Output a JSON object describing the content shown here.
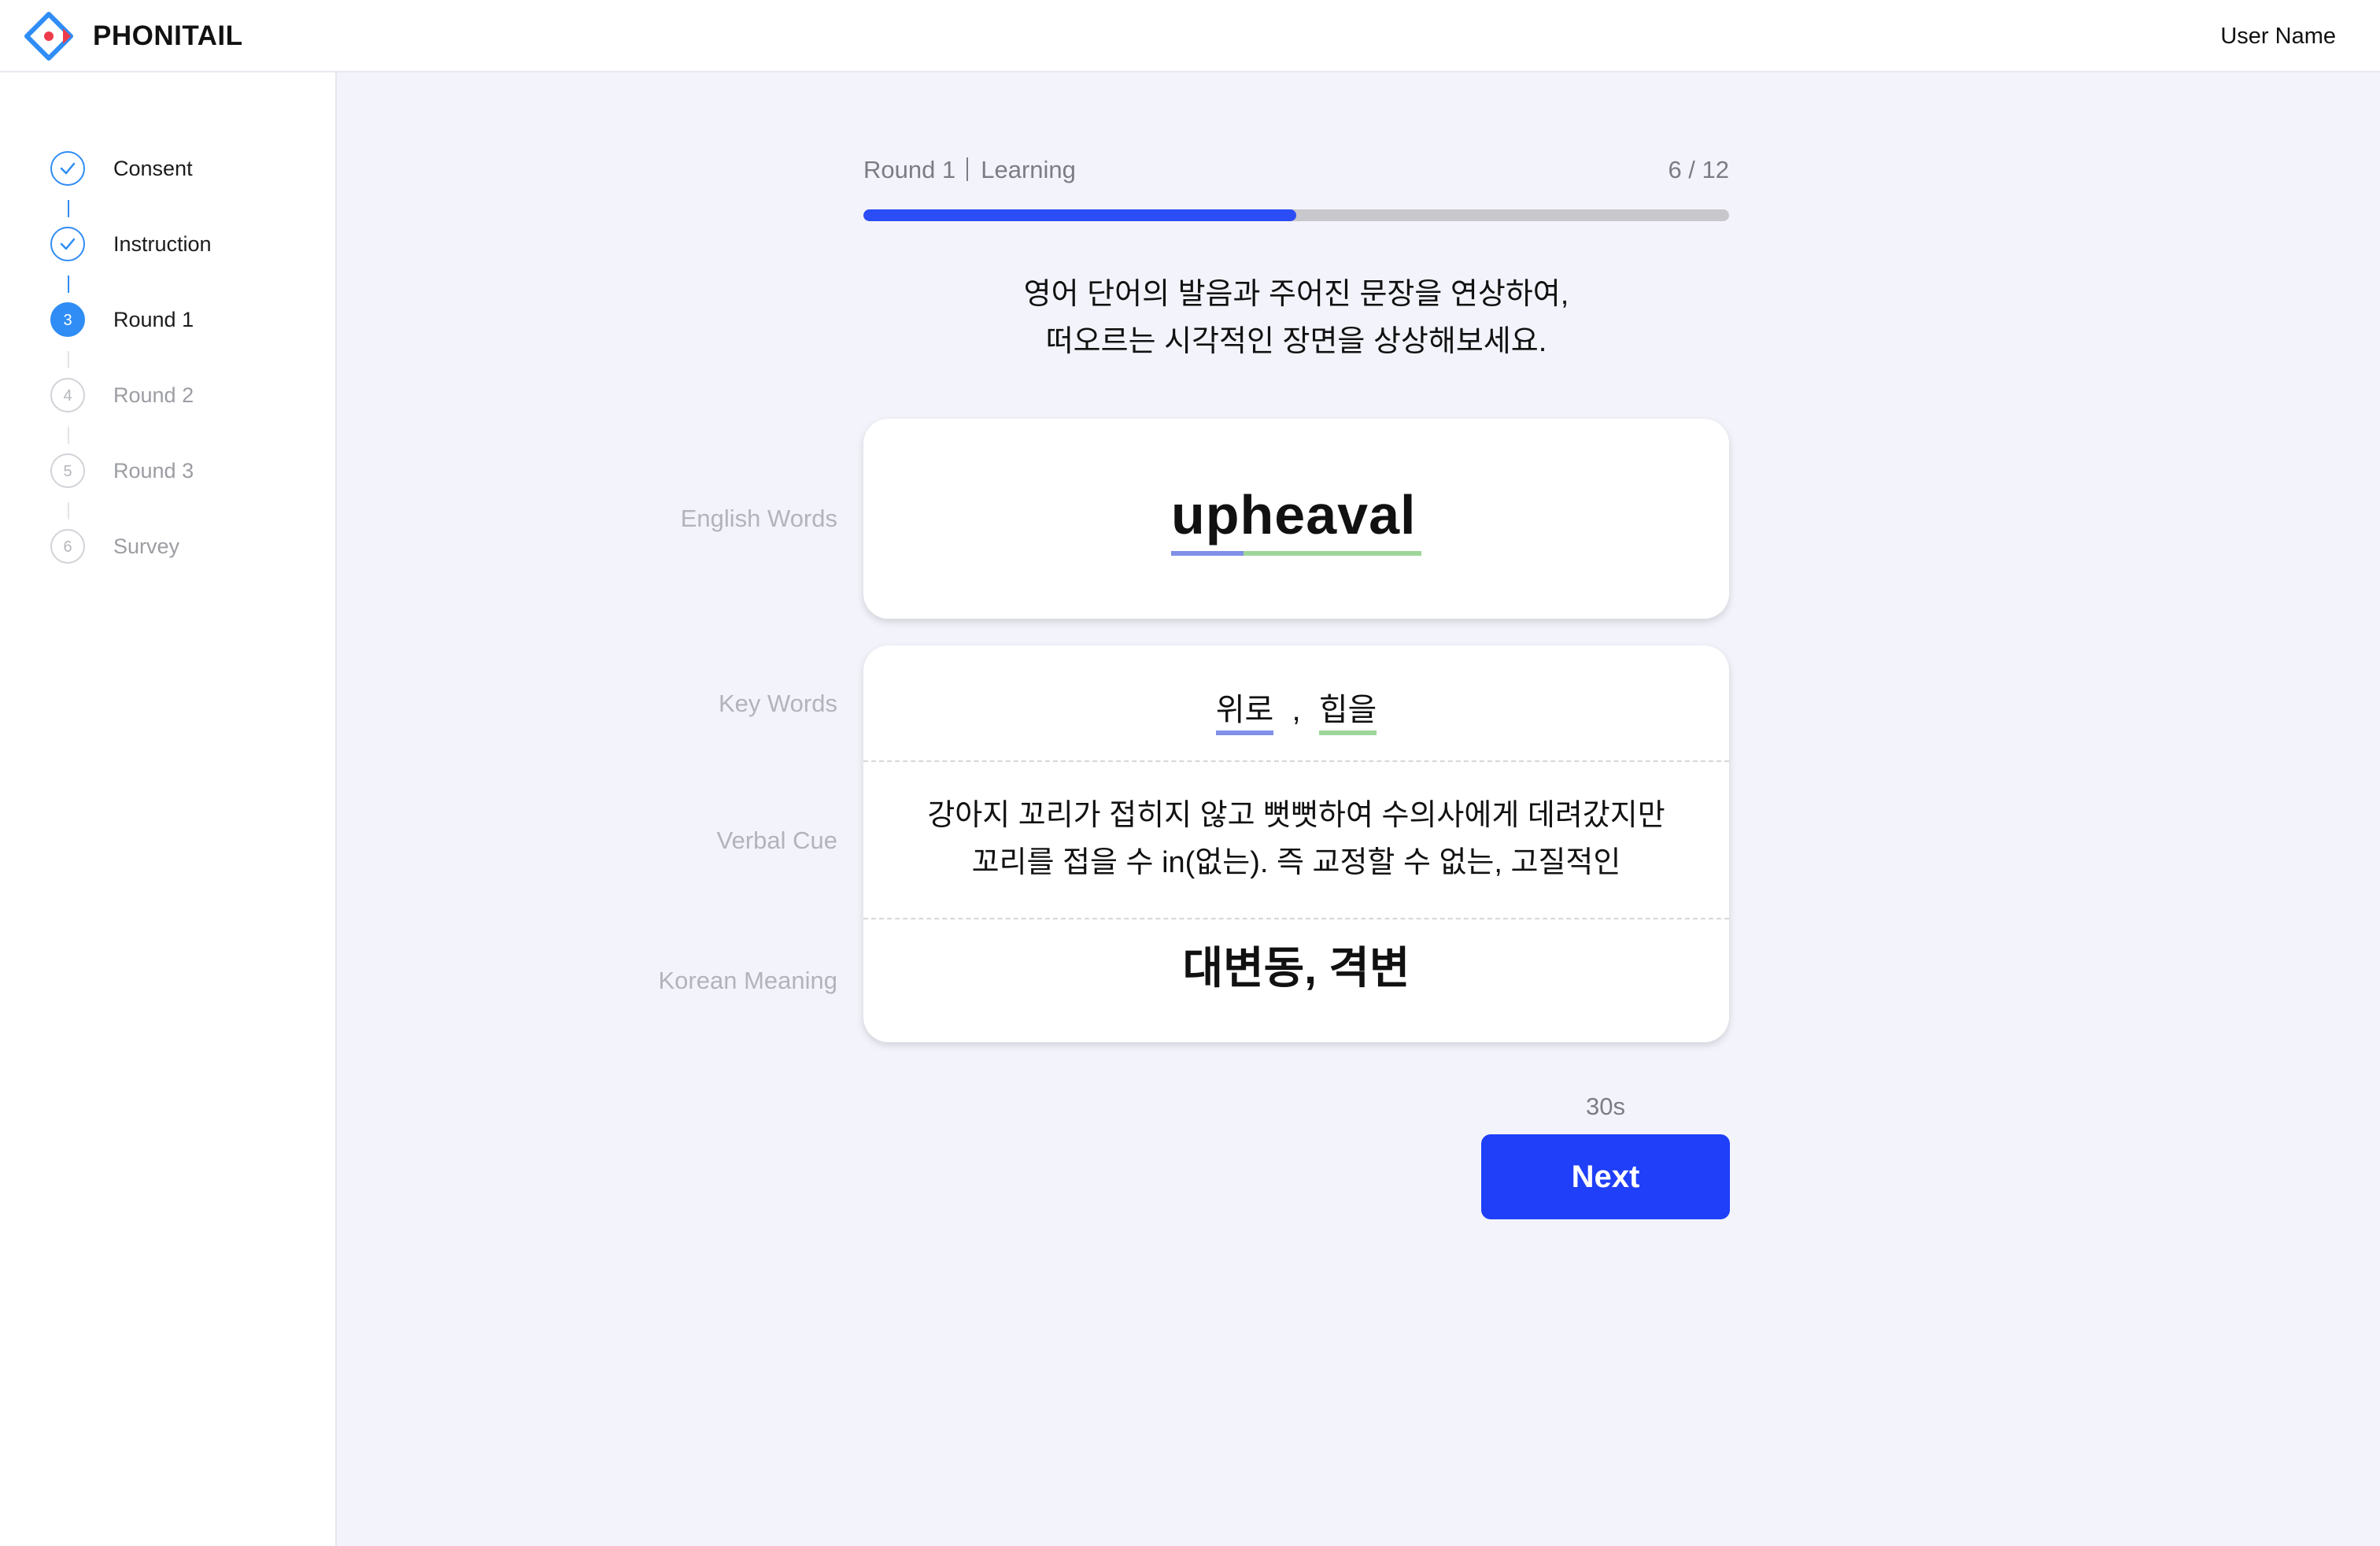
{
  "header": {
    "brand": "PHONITAIL",
    "user_name": "User Name",
    "logo_colors": {
      "blue": "#2f8df5",
      "red": "#ee3b4a"
    }
  },
  "sidebar": {
    "steps": [
      {
        "number": "1",
        "label": "Consent",
        "state": "done"
      },
      {
        "number": "2",
        "label": "Instruction",
        "state": "done"
      },
      {
        "number": "3",
        "label": "Round 1",
        "state": "active"
      },
      {
        "number": "4",
        "label": "Round 2",
        "state": "pending"
      },
      {
        "number": "5",
        "label": "Round 3",
        "state": "pending"
      },
      {
        "number": "6",
        "label": "Survey",
        "state": "pending"
      }
    ]
  },
  "progress": {
    "round": "Round 1",
    "phase": "Learning",
    "counter": "6 / 12",
    "fraction": 0.5
  },
  "instruction": {
    "line1": "영어 단어의 발음과 주어진 문장을 연상하여,",
    "line2": "떠오르는 시각적인 장면을 상상해보세요."
  },
  "labels": {
    "english_words": "English Words",
    "key_words": "Key Words",
    "verbal_cue": "Verbal Cue",
    "korean_meaning": "Korean Meaning"
  },
  "card": {
    "english_word": "upheaval",
    "keyword_1": "위로",
    "keyword_sep": ",",
    "keyword_2": "힙을",
    "cue_line1": "강아지 꼬리가 접히지 않고 뻣뻣하여 수의사에게 데려갔지만",
    "cue_line2": "꼬리를 접을 수 in(없는). 즉 교정할 수 없는, 고질적인",
    "korean_meaning": "대변동, 격변"
  },
  "timer": "30s",
  "next_label": "Next",
  "colors": {
    "accent": "#1f3ff8",
    "progress_fill": "#2a4df5",
    "step_blue": "#2f8df5",
    "underline_first": "#8090e8",
    "underline_second": "#9ed69a"
  }
}
